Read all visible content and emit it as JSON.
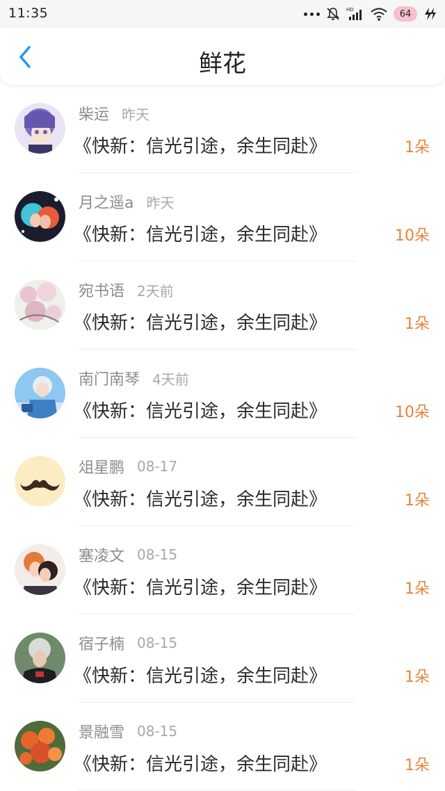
{
  "status_bar": {
    "time": "11:35",
    "battery": "64",
    "icons": [
      "more-dots-icon",
      "mute-bell-icon",
      "signal-hd-icon",
      "wifi-icon",
      "battery-badge",
      "charging-icon"
    ]
  },
  "header": {
    "title": "鲜花",
    "back_icon": "chevron-left-icon"
  },
  "colors": {
    "accent": "#2196f3",
    "count": "#e8833a"
  },
  "items": [
    {
      "name": "柴运",
      "time": "昨天",
      "book": "《快新：信光引途，余生同赴》",
      "count": "1朵",
      "avatar": "avatar-anime-girl-purple"
    },
    {
      "name": "月之遥a",
      "time": "昨天",
      "book": "《快新：信光引途，余生同赴》",
      "count": "10朵",
      "avatar": "avatar-anime-couple"
    },
    {
      "name": "宛书语",
      "time": "2天前",
      "book": "《快新：信光引途，余生同赴》",
      "count": "1朵",
      "avatar": "avatar-cherry-blossom"
    },
    {
      "name": "南门南琴",
      "time": "4天前",
      "book": "《快新：信光引途，余生同赴》",
      "count": "10朵",
      "avatar": "avatar-anime-boy-blue"
    },
    {
      "name": "俎星鹏",
      "time": "08-17",
      "book": "《快新：信光引途，余生同赴》",
      "count": "1朵",
      "avatar": "avatar-mustache"
    },
    {
      "name": "塞凌文",
      "time": "08-15",
      "book": "《快新：信光引途，余生同赴》",
      "count": "1朵",
      "avatar": "avatar-anime-kiss"
    },
    {
      "name": "宿子楠",
      "time": "08-15",
      "book": "《快新：信光引途，余生同赴》",
      "count": "1朵",
      "avatar": "avatar-girl-photo"
    },
    {
      "name": "景融雪",
      "time": "08-15",
      "book": "《快新：信光引途，余生同赴》",
      "count": "1朵",
      "avatar": "avatar-orange-flowers"
    }
  ]
}
